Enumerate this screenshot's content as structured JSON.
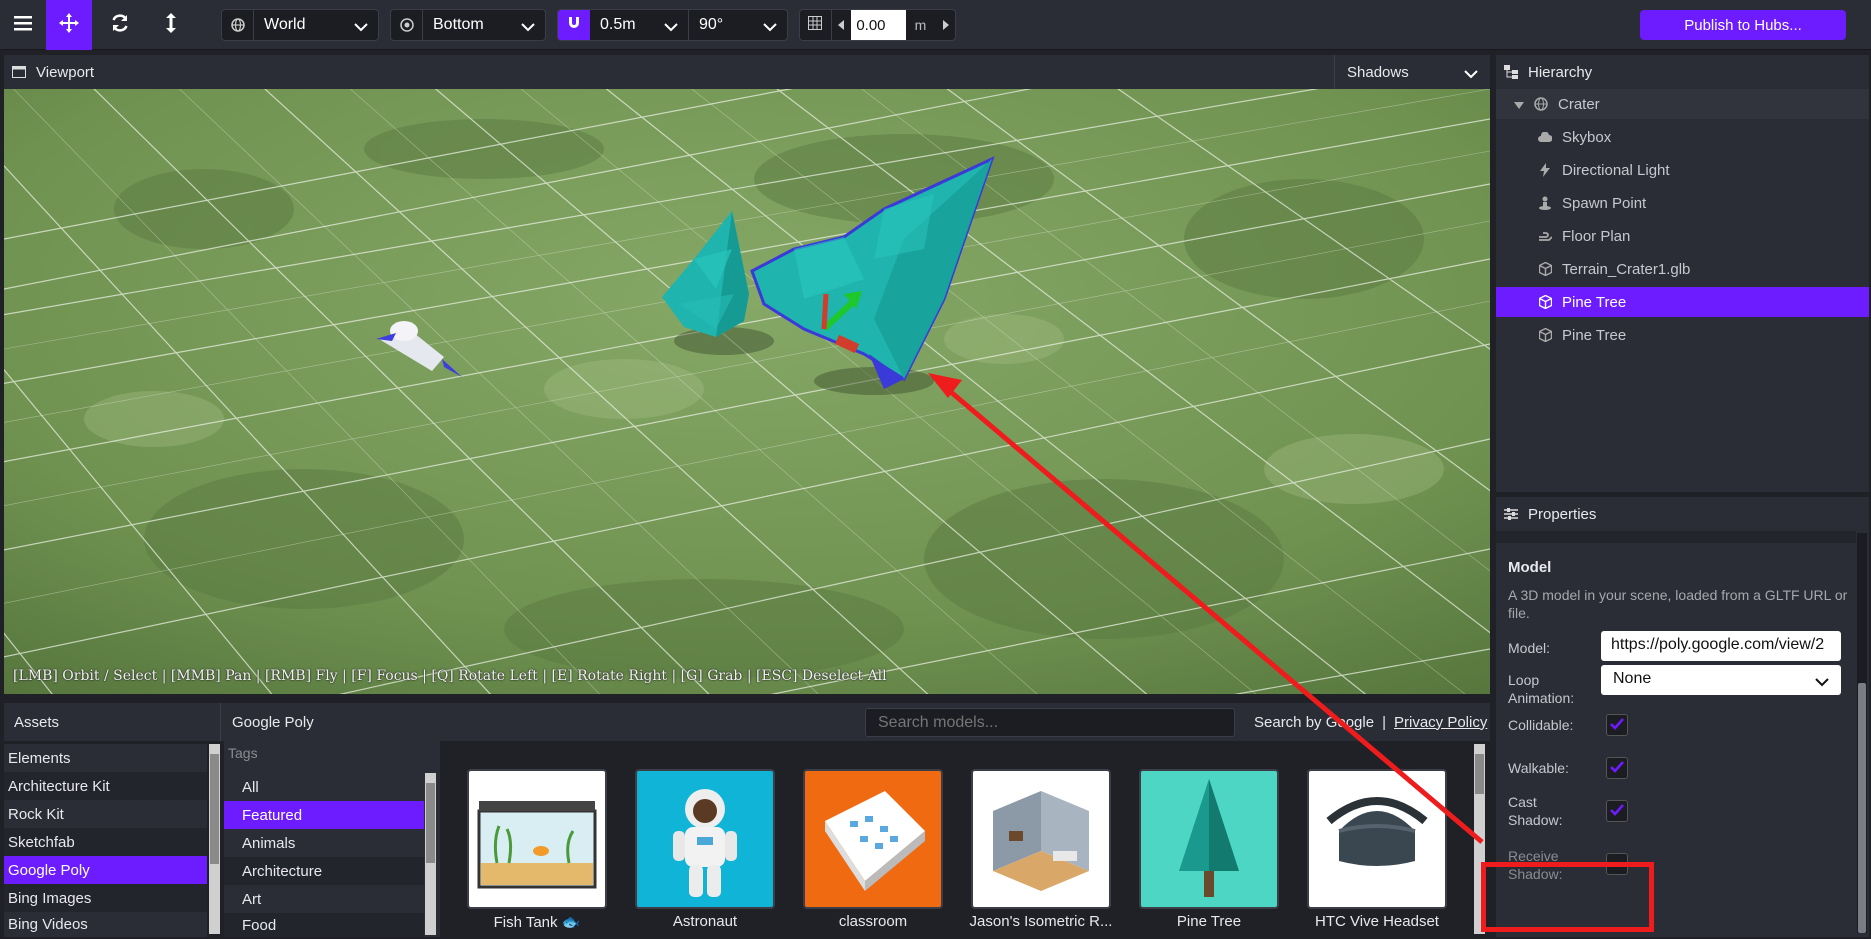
{
  "toolbar": {
    "space_select": "World",
    "pivot_select": "Bottom",
    "snap_translate": "0.5m",
    "snap_rotate": "90°",
    "grid_height": "0.00",
    "grid_unit": "m",
    "publish_label": "Publish to Hubs..."
  },
  "viewport": {
    "title": "Viewport",
    "shadows_select": "Shadows",
    "hint": "[LMB] Orbit / Select | [MMB] Pan | [RMB] Fly | [F] Focus | [Q] Rotate Left | [E] Rotate Right | [G] Grab | [ESC] Deselect All"
  },
  "hierarchy": {
    "title": "Hierarchy",
    "items": [
      {
        "label": "Crater",
        "icon": "globe-icon"
      },
      {
        "label": "Skybox",
        "icon": "cloud-icon"
      },
      {
        "label": "Directional Light",
        "icon": "bolt-icon"
      },
      {
        "label": "Spawn Point",
        "icon": "spawn-icon"
      },
      {
        "label": "Floor Plan",
        "icon": "hand-icon"
      },
      {
        "label": "Terrain_Crater1.glb",
        "icon": "cube-icon"
      },
      {
        "label": "Pine Tree",
        "icon": "cube-icon"
      },
      {
        "label": "Pine Tree",
        "icon": "cube-icon"
      }
    ]
  },
  "properties": {
    "title": "Properties",
    "section_title": "Model",
    "description": "A 3D model in your scene, loaded from a GLTF URL or file.",
    "model_label": "Model:",
    "model_url": "https://poly.google.com/view/2",
    "loop_animation_label": "Loop Animation:",
    "loop_animation_value": "None",
    "collidable_label": "Collidable:",
    "collidable": true,
    "walkable_label": "Walkable:",
    "walkable": true,
    "cast_shadow_label": "Cast Shadow:",
    "cast_shadow": true,
    "receive_shadow_label": "Receive Shadow:",
    "receive_shadow": false
  },
  "assets": {
    "title": "Assets",
    "sources": [
      "Elements",
      "Architecture Kit",
      "Rock Kit",
      "Sketchfab",
      "Google Poly",
      "Bing Images",
      "Bing Videos"
    ],
    "selected_source": "Google Poly",
    "panel_title": "Google Poly",
    "search_placeholder": "Search models...",
    "search_by": "Search by Google",
    "separator": "|",
    "privacy": "Privacy Policy",
    "tags_header": "Tags",
    "tags": [
      "All",
      "Featured",
      "Animals",
      "Architecture",
      "Art",
      "Food"
    ],
    "selected_tag": "Featured",
    "models": [
      "Fish Tank 🐟",
      "Astronaut",
      "classroom",
      "Jason's Isometric R...",
      "Pine Tree",
      "HTC Vive Headset"
    ]
  },
  "colors": {
    "accent": "#6d1bff",
    "panel": "#2a2d35",
    "annotation": "#ee1c1c"
  }
}
